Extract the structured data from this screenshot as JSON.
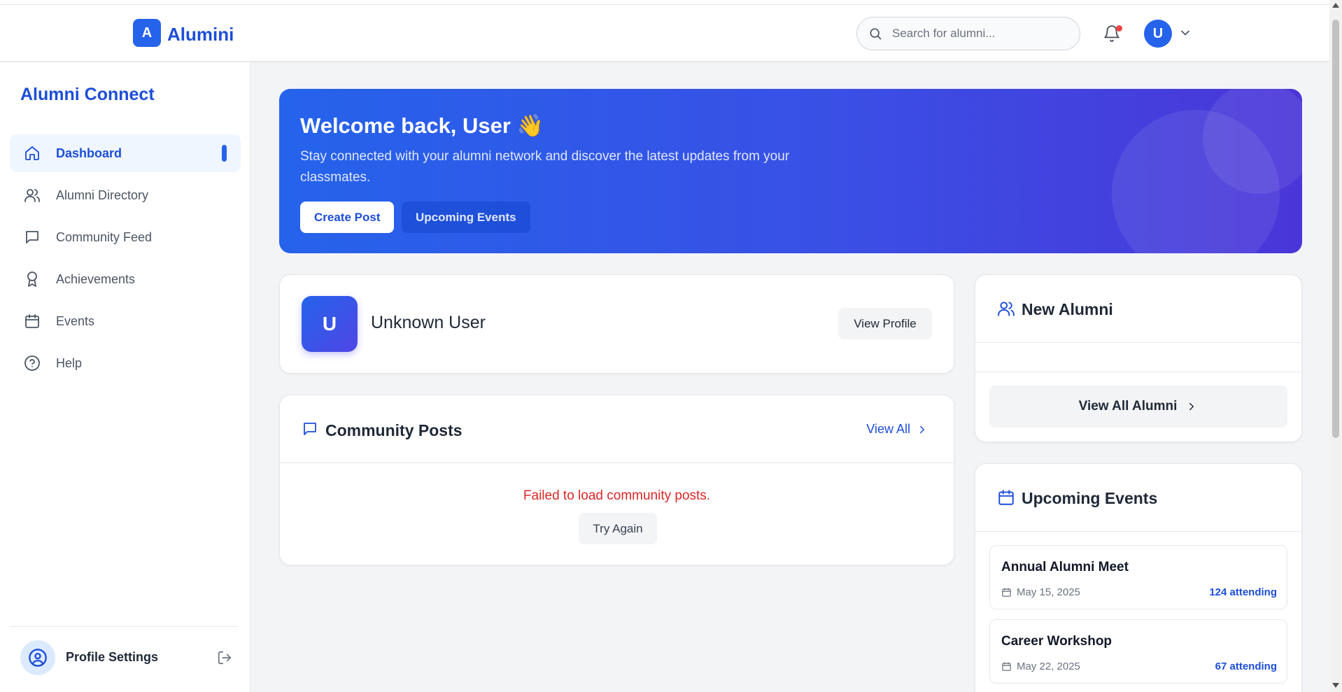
{
  "header": {
    "logo_letter": "A",
    "logo_text": "Alumini",
    "search_placeholder": "Search for alumni...",
    "avatar_letter": "U"
  },
  "sidebar": {
    "brand": "Alumni Connect",
    "items": [
      {
        "label": "Dashboard",
        "icon": "home-icon",
        "active": true
      },
      {
        "label": "Alumni Directory",
        "icon": "users-icon",
        "active": false
      },
      {
        "label": "Community Feed",
        "icon": "message-icon",
        "active": false
      },
      {
        "label": "Achievements",
        "icon": "award-icon",
        "active": false
      },
      {
        "label": "Events",
        "icon": "calendar-icon",
        "active": false
      },
      {
        "label": "Help",
        "icon": "help-circle-icon",
        "active": false
      }
    ],
    "footer_label": "Profile Settings"
  },
  "hero": {
    "title": "Welcome back, User 👋",
    "subtitle": "Stay connected with your alumni network and discover the latest updates from your classmates.",
    "primary_button": "Create Post",
    "secondary_button": "Upcoming Events"
  },
  "profile": {
    "avatar_letter": "U",
    "name": "Unknown User",
    "button": "View Profile"
  },
  "community_posts": {
    "title": "Community Posts",
    "view_all": "View All",
    "error": "Failed to load community posts.",
    "retry": "Try Again"
  },
  "new_alumni": {
    "title": "New Alumni",
    "button": "View All Alumni"
  },
  "upcoming_events": {
    "title": "Upcoming Events",
    "events": [
      {
        "name": "Annual Alumni Meet",
        "date": "May 15, 2025",
        "attending": "124 attending"
      },
      {
        "name": "Career Workshop",
        "date": "May 22, 2025",
        "attending": "67 attending"
      }
    ]
  },
  "colors": {
    "accent": "#2563eb",
    "error": "#dc2626",
    "notification_dot": "#ef4444"
  }
}
